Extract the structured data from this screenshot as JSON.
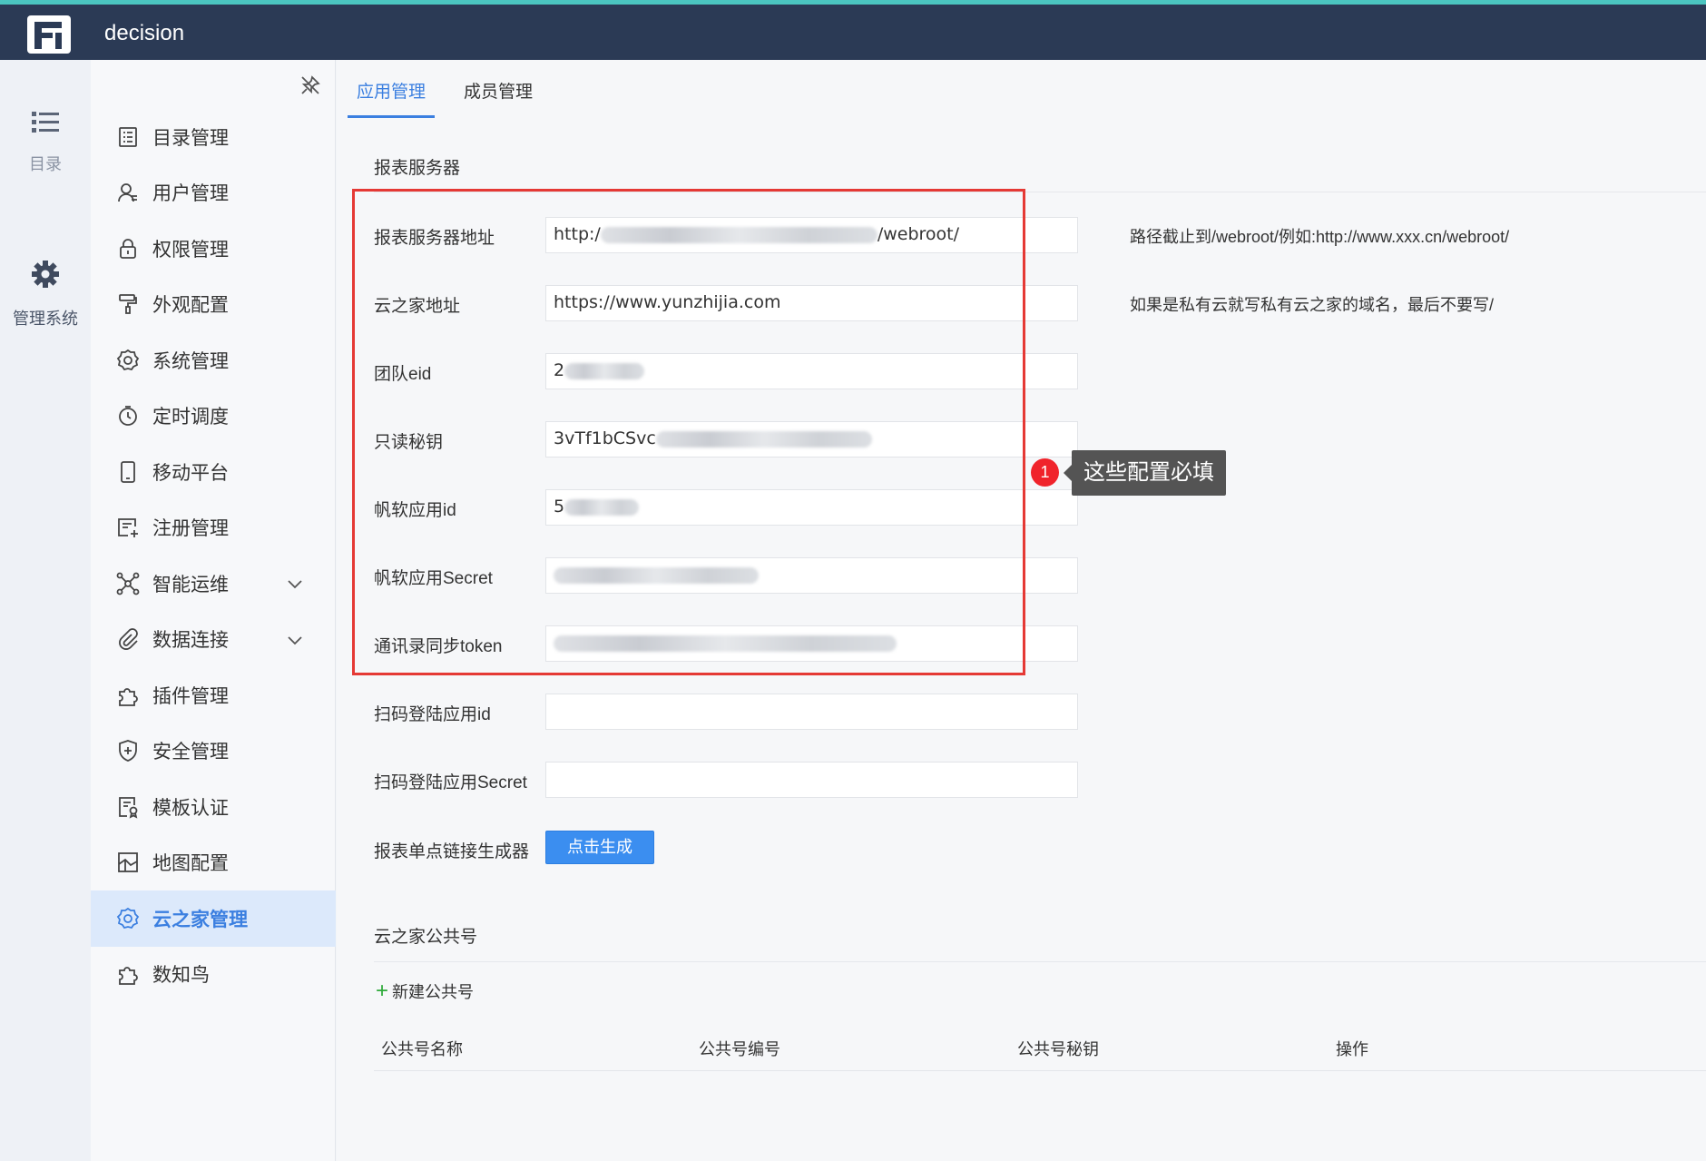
{
  "header": {
    "app_title": "decision"
  },
  "rail": [
    {
      "label": "目录",
      "icon": "list-icon"
    },
    {
      "label": "管理系统",
      "icon": "gear-icon"
    }
  ],
  "sidebar": {
    "items": [
      {
        "label": "目录管理",
        "icon": "catalog-icon"
      },
      {
        "label": "用户管理",
        "icon": "user-icon"
      },
      {
        "label": "权限管理",
        "icon": "lock-icon"
      },
      {
        "label": "外观配置",
        "icon": "paint-roller-icon"
      },
      {
        "label": "系统管理",
        "icon": "settings-icon"
      },
      {
        "label": "定时调度",
        "icon": "stopwatch-icon"
      },
      {
        "label": "移动平台",
        "icon": "mobile-icon"
      },
      {
        "label": "注册管理",
        "icon": "register-icon"
      },
      {
        "label": "智能运维",
        "icon": "network-icon",
        "expandable": true
      },
      {
        "label": "数据连接",
        "icon": "paperclip-icon",
        "expandable": true
      },
      {
        "label": "插件管理",
        "icon": "puzzle-icon"
      },
      {
        "label": "安全管理",
        "icon": "shield-icon"
      },
      {
        "label": "模板认证",
        "icon": "certificate-icon"
      },
      {
        "label": "地图配置",
        "icon": "map-icon"
      },
      {
        "label": "云之家管理",
        "icon": "settings-icon",
        "active": true
      },
      {
        "label": "数知鸟",
        "icon": "puzzle-icon"
      }
    ]
  },
  "tabs": [
    {
      "label": "应用管理",
      "active": true
    },
    {
      "label": "成员管理",
      "active": false
    }
  ],
  "report_server": {
    "title": "报表服务器",
    "fields": [
      {
        "label": "报表服务器地址",
        "value_prefix": "http:/",
        "value_suffix": "/webroot/",
        "hint": "路径截止到/webroot/例如:http://www.xxx.cn/webroot/"
      },
      {
        "label": "云之家地址",
        "value_prefix": "https://www.yunzhijia.com",
        "hint": "如果是私有云就写私有云之家的域名，最后不要写/"
      },
      {
        "label": "团队eid",
        "value_prefix": "2"
      },
      {
        "label": "只读秘钥",
        "value_prefix": "3vTf1bCSvc"
      },
      {
        "label": "帆软应用id",
        "value_prefix": "5"
      },
      {
        "label": "帆软应用Secret",
        "value_prefix": ""
      },
      {
        "label": "通讯录同步token",
        "value_prefix": ""
      },
      {
        "label": "扫码登陆应用id",
        "value_prefix": ""
      },
      {
        "label": "扫码登陆应用Secret",
        "value_prefix": ""
      }
    ],
    "link_generator": {
      "label": "报表单点链接生成器",
      "button": "点击生成"
    }
  },
  "callout": {
    "badge": "1",
    "text": "这些配置必填"
  },
  "public_accounts": {
    "title": "云之家公共号",
    "add_label": "新建公共号",
    "columns": [
      "公共号名称",
      "公共号编号",
      "公共号秘钥",
      "操作"
    ]
  }
}
